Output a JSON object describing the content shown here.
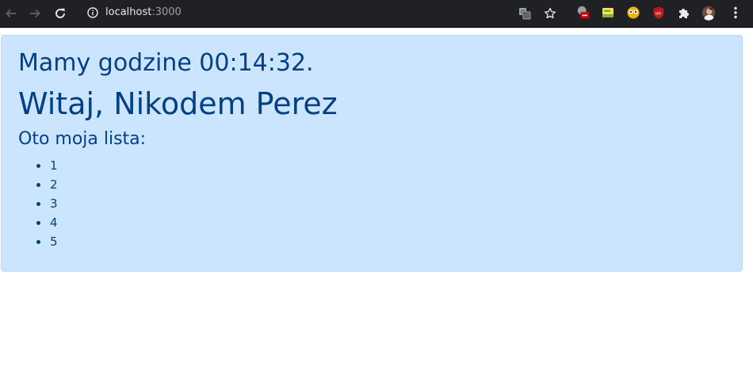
{
  "browser": {
    "url_host": "localhost",
    "url_port": ":3000",
    "extensions": [
      "ext-red-badge-icon",
      "ext-note-icon",
      "ext-eyes-icon",
      "ublock-icon",
      "extensions-puzzle-icon",
      "profile-avatar"
    ]
  },
  "page": {
    "time_line": "Mamy godzine 00:14:32.",
    "greeting": "Witaj, Nikodem Perez",
    "list_heading": "Oto moja lista:",
    "list_items": [
      "1",
      "2",
      "3",
      "4",
      "5"
    ]
  },
  "colors": {
    "alert_bg": "#cce5ff",
    "alert_border": "#b8daff",
    "alert_text": "#004085",
    "chrome_bg": "#202124"
  }
}
